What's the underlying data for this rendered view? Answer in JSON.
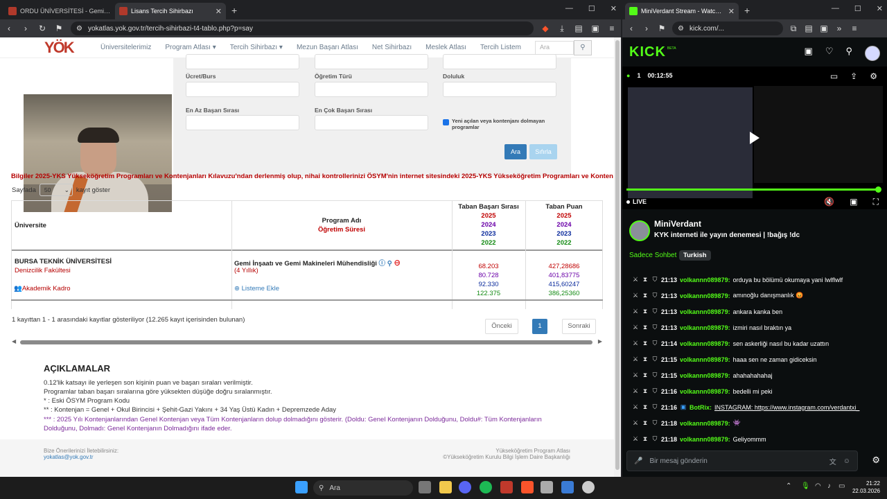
{
  "left_browser": {
    "tabs": [
      {
        "title": "ORDU ÜNİVERSİTESİ - Gemi İnşaatı (",
        "active": false
      },
      {
        "title": "Lisans Tercih Sihirbazı",
        "active": true
      }
    ],
    "url": "yokatlas.yok.gov.tr/tercih-sihirbazi-t4-tablo.php?p=say"
  },
  "site_nav": {
    "logo": "YÖK",
    "items": [
      "Üniversitelerimiz",
      "Program Atlası",
      "Tercih Sihirbazı",
      "Mezun Başarı Atlası",
      "Net Sihirbazı",
      "Meslek Atlası",
      "Tercih Listem"
    ],
    "search_placeholder": "Ara"
  },
  "filters": {
    "label_ucret": "Ücret/Burs",
    "label_ogretim": "Öğretim Türü",
    "label_doluluk": "Doluluk",
    "label_en_az": "En Az Başarı Sırası",
    "label_en_cok": "En Çok Başarı Sırası",
    "checkbox_label": "Yeni açılan veya kontenjanı dolmayan programlar",
    "btn_ara": "Ara",
    "btn_sifirla": "Sıfırla"
  },
  "notice": "Bilgiler 2025-YKS Yükseköğretim Programları ve Kontenjanları Kılavuzu'ndan derlenmiş olup, nihai kontrollerinizi ÖSYM'nin internet sitesindeki 2025-YKS Yükseköğretim Programları ve Konten",
  "per_page": {
    "before": "Sayfada",
    "value": "50",
    "after": "kayıt göster"
  },
  "table": {
    "headers": {
      "universite": "Üniversite",
      "program": "Program Adı",
      "program_sub": "Öğretim Süresi",
      "basari": "Taban Başarı Sırası",
      "puan": "Taban Puan",
      "years": [
        "2025",
        "2024",
        "2023",
        "2022"
      ]
    },
    "row": {
      "universite": "BURSA TEKNİK ÜNİVERSİTESİ",
      "fakulte": "Denizcilik Fakültesi",
      "kadro": "Akademik Kadro",
      "program": "Gemi İnşaatı ve Gemi Makineleri Mühendisliği",
      "sure": "(4 Yıllık)",
      "ekle": "Listeme Ekle",
      "basari": [
        "68.203",
        "80.728",
        "92.330",
        "122.375"
      ],
      "puan": [
        "427,28686",
        "401,83775",
        "415,60247",
        "386,25360"
      ]
    }
  },
  "info_line": "1 kayıttan 1 - 1 arasındaki kayıtlar gösteriliyor (12.265 kayıt içerisinden bulunan)",
  "pagination": {
    "prev": "Önceki",
    "current": "1",
    "next": "Sonraki"
  },
  "aciklamalar": {
    "title": "AÇIKLAMALAR",
    "lines": [
      "0.12'lik katsayı ile yerleşen son kişinin puan ve başarı sıraları verilmiştir.",
      "Programlar taban başarı sıralarına göre yüksekten düşüğe doğru sıralanmıştır.",
      "* : Eski ÖSYM Program Kodu",
      "** : Kontenjan = Genel + Okul Birincisi + Şehit-Gazi Yakını + 34 Yaş Üstü Kadın + Depremzede Aday",
      "*** : 2025 Yılı Kontenjanlarından Genel Kontenjan veya Tüm Kontenjanların dolup dolmadığını gösterir. (Doldu: Genel Kontenjanın Dolduğunu, Doldu#: Tüm Kontenjanların",
      "Dolduğunu, Dolmadı: Genel Kontenjanın Dolmadığını ifade eder."
    ]
  },
  "footer": {
    "left1": "Bize Önerilerinizi İletebilirsiniz:",
    "left2": "yokatlas@yok.gov.tr",
    "right1": "Yükseköğretim Program Atlası",
    "right2": "©Yükseköğretim Kurulu Bilgi İşlem Daire Başkanlığı"
  },
  "right_browser": {
    "tab": "MiniVerdant Stream - Watch Live",
    "url": "kick.com/...",
    "logo": "KICK",
    "logo_beta": "BETA",
    "viewers": "1",
    "uptime": "00:12:55",
    "live": "LIVE",
    "channel": "MiniVerdant",
    "stream_title": "KYK interneti ile yayın denemesi | !bağış !dc",
    "chat_mode": "Sadece Sohbet",
    "language": "Turkish",
    "chat": [
      {
        "time": "21:13",
        "user": "volkannn089879",
        "text": "orduya bu bölümü okumaya yani lwlflwlf"
      },
      {
        "time": "21:13",
        "user": "volkannn089879",
        "text": "amınoğlu danışmanlık 😡"
      },
      {
        "time": "21:13",
        "user": "volkannn089879",
        "text": "ankara kanka ben"
      },
      {
        "time": "21:13",
        "user": "volkannn089879",
        "text": "izmiri nasıl braktın ya"
      },
      {
        "time": "21:14",
        "user": "volkannn089879",
        "text": "sen askerliği nasıl bu kadar uzattın"
      },
      {
        "time": "21:15",
        "user": "volkannn089879",
        "text": "haaa sen ne zaman gidiceksin"
      },
      {
        "time": "21:15",
        "user": "volkannn089879",
        "text": "ahahahahahaj"
      },
      {
        "time": "21:16",
        "user": "volkannn089879",
        "text": "bedelli mi peki"
      },
      {
        "time": "21:16",
        "user": "BotRix",
        "text": "INSTAGRAM: https://www.instagram.com/verdantxi_"
      },
      {
        "time": "21:18",
        "user": "volkannn089879",
        "text": "👾"
      },
      {
        "time": "21:18",
        "user": "volkannn089879",
        "text": "Geliyommm"
      }
    ],
    "chat_placeholder": "Bir mesaj gönderin"
  },
  "taskbar": {
    "search": "Ara",
    "time": "21:22",
    "date": "22.03.2026"
  }
}
